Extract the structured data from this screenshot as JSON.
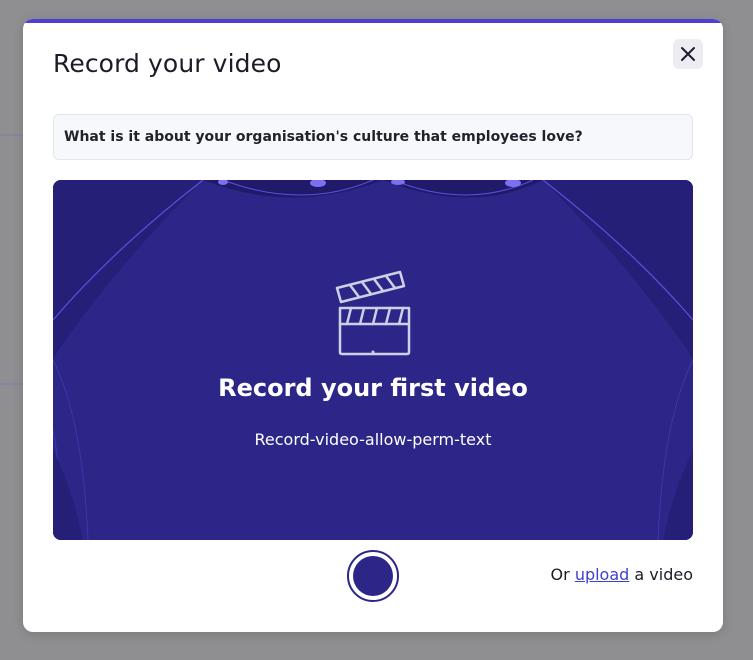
{
  "modal": {
    "title": "Record your video",
    "close_icon": "close-icon",
    "question": "What is it about your organisation's culture that employees love?"
  },
  "stage": {
    "icon": "clapperboard-icon",
    "heading": "Record your first video",
    "text": "Record-video-allow-perm-text"
  },
  "controls": {
    "record_icon": "record-dot-icon",
    "upload_prefix": "Or",
    "upload_link": "upload",
    "upload_suffix": "a video"
  },
  "colors": {
    "accent": "#4b3fd6",
    "stage_bg": "#2c2688",
    "curtain_line": "#5a4fe0",
    "link": "#3f3fd0"
  }
}
